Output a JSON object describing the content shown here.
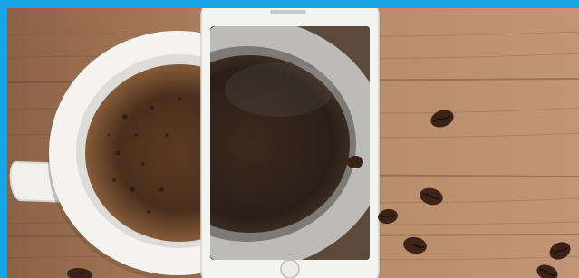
{
  "scene": {
    "subject": "coffee-cup-with-smartphone",
    "colors": {
      "frame": "#18a5e6",
      "wood_light": "#b88d68",
      "wood_mid": "#9b7154",
      "wood_dark": "#6f4b34",
      "cup": "#f2f1ee",
      "coffee": "#3a2517",
      "crema": "#9a6b45",
      "phone_body": "#f3f3f1",
      "phone_screen": "#2b2723"
    }
  }
}
